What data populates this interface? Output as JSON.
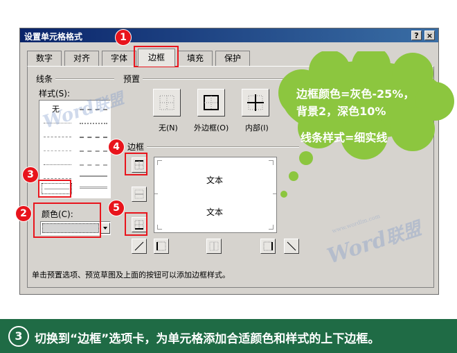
{
  "dialog": {
    "title": "设置单元格格式",
    "help_label": "?",
    "close_label": "×",
    "tabs": [
      {
        "label": "数字"
      },
      {
        "label": "对齐"
      },
      {
        "label": "字体"
      },
      {
        "label": "边框"
      },
      {
        "label": "填充"
      },
      {
        "label": "保护"
      }
    ],
    "active_tab": "边框"
  },
  "line_group": {
    "title": "线条",
    "style_label": "样式(S):",
    "none_label": "无",
    "color_label": "颜色(C):",
    "color_value": "",
    "selected_style": "细实线"
  },
  "presets": {
    "title": "预置",
    "none_label": "无(N)",
    "outline_label": "外边框(O)",
    "inside_label": "内部(I)"
  },
  "border": {
    "title": "边框",
    "preview_text_top": "文本",
    "preview_text_bottom": "文本"
  },
  "hint": "单击预置选项、预览草图及上面的按钮可以添加边框样式。",
  "annotations": {
    "badges": [
      "1",
      "2",
      "3",
      "4",
      "5"
    ],
    "callout_line1": "边框颜色=灰色-25%，",
    "callout_line2": "背景2，深色10%",
    "callout_line3": "线条样式=细实线"
  },
  "watermark": {
    "word": "Word",
    "cn": "联盟",
    "url": "www.wordlm.com"
  },
  "footer": {
    "step_number": "3",
    "instruction": "切换到“边框”选项卡，为单元格添加合适颜色和样式的上下边框。"
  },
  "colors": {
    "title_bar": "#0a246a",
    "dialog_bg": "#d6d3ce",
    "annotation_red": "#e8141c",
    "callout_green": "#8cc63f",
    "footer_green": "#1f6b45"
  }
}
